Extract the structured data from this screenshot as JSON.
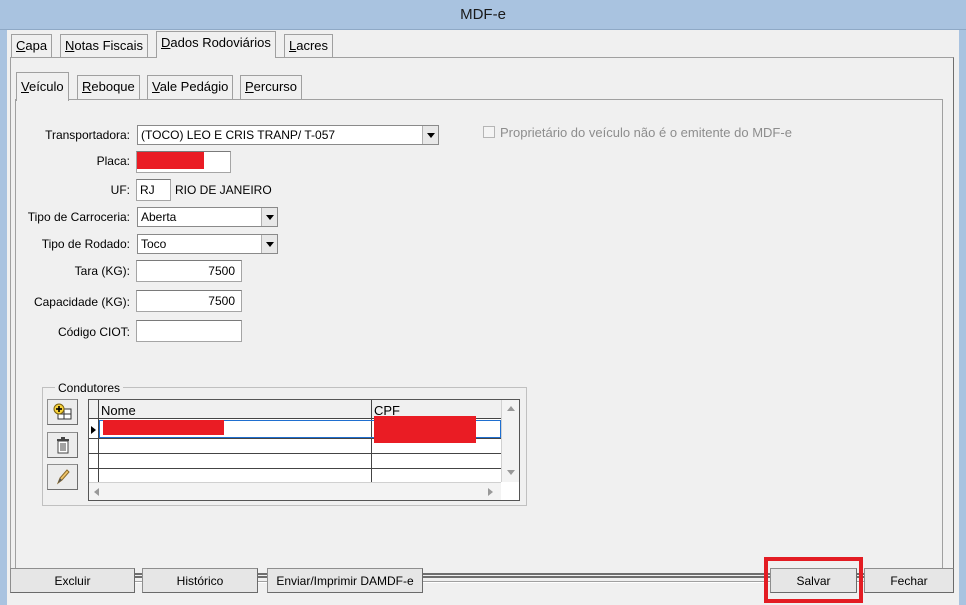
{
  "window": {
    "title": "MDF-e"
  },
  "main_tabs": [
    {
      "label": "Capa",
      "u": "C",
      "rest": "apa"
    },
    {
      "label": "Notas Fiscais",
      "u": "N",
      "rest": "otas Fiscais"
    },
    {
      "label": "Dados Rodoviários",
      "u": "D",
      "rest": "ados Rodoviários"
    },
    {
      "label": "Lacres",
      "u": "L",
      "rest": "acres"
    }
  ],
  "sub_tabs": [
    {
      "label": "Veículo",
      "u": "V",
      "rest": "eículo"
    },
    {
      "label": "Reboque",
      "u": "R",
      "rest": "eboque"
    },
    {
      "label": "Vale Pedágio",
      "u": "V",
      "rest": "ale Pedágio"
    },
    {
      "label": "Percurso",
      "u": "P",
      "rest": "ercurso"
    }
  ],
  "form": {
    "transportadora_label": "Transportadora:",
    "transportadora_value": "(TOCO) LEO E CRIS TRANP/ T-057",
    "placa_label": "Placa:",
    "uf_label": "UF:",
    "uf_value": "RJ",
    "uf_name": "RIO DE JANEIRO",
    "carroceria_label": "Tipo de Carroceria:",
    "carroceria_value": "Aberta",
    "rodado_label": "Tipo de Rodado:",
    "rodado_value": "Toco",
    "tara_label": "Tara (KG):",
    "tara_value": "7500",
    "capacidade_label": "Capacidade (KG):",
    "capacidade_value": "7500",
    "ciot_label": "Código CIOT:",
    "ciot_value": "",
    "proprietario_label": "Proprietário do veículo não é o emitente do MDF-e"
  },
  "condutores": {
    "title": "Condutores",
    "columns": [
      "Nome",
      "CPF"
    ]
  },
  "buttons": {
    "excluir": "Excluir",
    "historico": "Histórico",
    "enviar": "Enviar/Imprimir DAMDF-e",
    "salvar": "Salvar",
    "fechar": "Fechar"
  }
}
